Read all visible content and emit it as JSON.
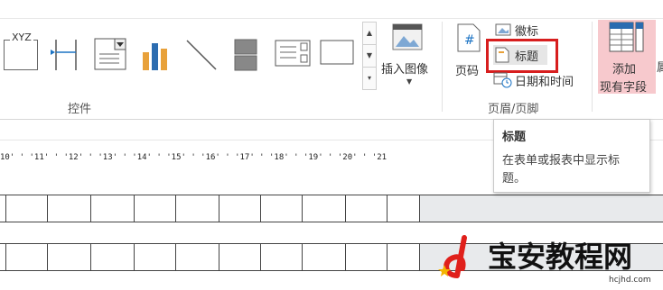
{
  "ribbon": {
    "controls_group_label": "控件",
    "gallery_first_label": "XYZ",
    "insert_image_label": "插入图像",
    "page_number_label": "页码",
    "logo_label": "徽标",
    "title_label": "标题",
    "datetime_label": "日期和时间",
    "header_footer_group_label": "页眉/页脚",
    "add_fields_label_line1": "添加",
    "add_fields_label_line2": "现有字段",
    "cut_char": "属"
  },
  "tooltip": {
    "title": "标题",
    "body_line1": "在表单或报表中显示标",
    "body_line2": "题。"
  },
  "ruler": {
    "text": "10' ' '11' ' '12' ' '13' ' '14' ' '15' ' '16' ' '17' ' '18' ' '19' ' '20' ' '21"
  },
  "watermark": {
    "text": "宝安教程网",
    "url": "hcjhd.com"
  },
  "colors": {
    "highlight_border": "#d71e1e",
    "add_field_bg": "#f7c9cd",
    "watermark_red": "#e0201b"
  }
}
